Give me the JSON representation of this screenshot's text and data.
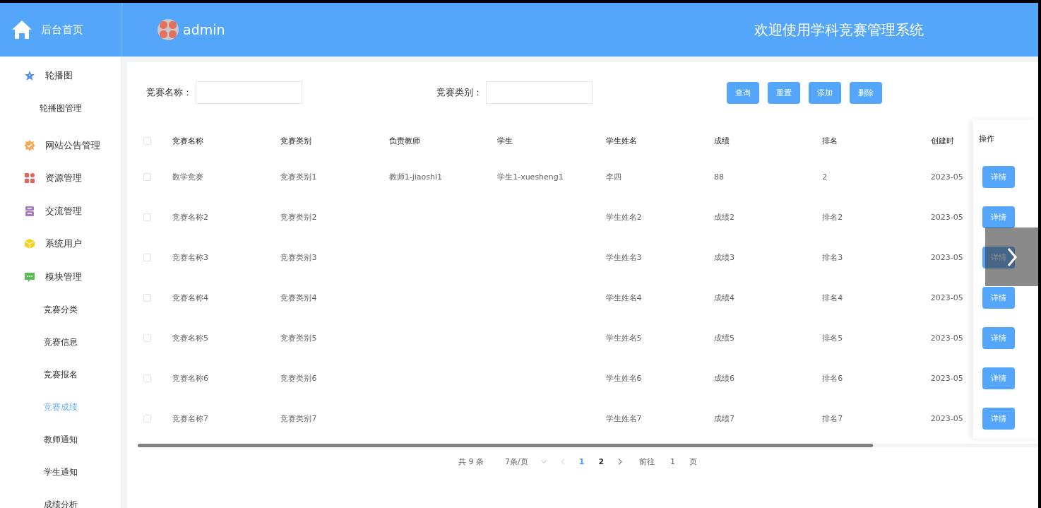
{
  "header": {
    "home_label": "后台首页",
    "username": "admin",
    "title": "欢迎使用学科竞赛管理系统"
  },
  "sidebar": {
    "groups": [
      {
        "label": "轮播图",
        "kind": "star",
        "children": [
          {
            "label": "轮播图管理",
            "selected": false
          }
        ]
      },
      {
        "label": "网站公告管理",
        "kind": "badge"
      },
      {
        "label": "资源管理",
        "kind": "grid"
      },
      {
        "label": "交流管理",
        "kind": "box"
      },
      {
        "label": "系统用户",
        "kind": "cube"
      },
      {
        "label": "模块管理",
        "kind": "chat",
        "children": [
          {
            "label": "竞赛分类",
            "selected": false
          },
          {
            "label": "竞赛信息",
            "selected": false
          },
          {
            "label": "竞赛报名",
            "selected": false
          },
          {
            "label": "竞赛成绩",
            "selected": true
          },
          {
            "label": "教师通知",
            "selected": false
          },
          {
            "label": "学生通知",
            "selected": false
          },
          {
            "label": "成绩分析",
            "selected": false
          }
        ]
      }
    ]
  },
  "search": {
    "fields": [
      {
        "label": "竞赛名称："
      },
      {
        "label": "竞赛类别："
      }
    ],
    "buttons": [
      "查询",
      "重置",
      "添加",
      "删除"
    ]
  },
  "table": {
    "header_checked": false,
    "columns": [
      "竞赛名称",
      "竞赛类别",
      "负责教师",
      "学生",
      "学生姓名",
      "成绩",
      "排名",
      "创建时"
    ],
    "action_column": "操作",
    "rows": [
      {
        "checked": false,
        "name": "数学竞赛",
        "category": "竞赛类别1",
        "teacher": "教师1-jiaoshi1",
        "student": "学生1-xuesheng1",
        "student_name": "李四",
        "score": "88",
        "rank": "2",
        "created": "2023-05",
        "action": "详情"
      },
      {
        "checked": false,
        "name": "竞赛名称2",
        "category": "竞赛类别2",
        "student_name": "学生姓名2",
        "score": "成绩2",
        "rank": "排名2",
        "created": "2023-05",
        "action": "详情"
      },
      {
        "checked": false,
        "name": "竞赛名称3",
        "category": "竞赛类别3",
        "student_name": "学生姓名3",
        "score": "成绩3",
        "rank": "排名3",
        "created": "2023-05",
        "action": "详情"
      },
      {
        "checked": false,
        "name": "竞赛名称4",
        "category": "竞赛类别4",
        "student_name": "学生姓名4",
        "score": "成绩4",
        "rank": "排名4",
        "created": "2023-05",
        "action": "详情"
      },
      {
        "checked": false,
        "name": "竞赛名称5",
        "category": "竞赛类别5",
        "student_name": "学生姓名5",
        "score": "成绩5",
        "rank": "排名5",
        "created": "2023-05",
        "action": "详情"
      },
      {
        "checked": false,
        "name": "竞赛名称6",
        "category": "竞赛类别6",
        "student_name": "学生姓名6",
        "score": "成绩6",
        "rank": "排名6",
        "created": "2023-05",
        "action": "详情"
      },
      {
        "checked": false,
        "name": "竞赛名称7",
        "category": "竞赛类别7",
        "student_name": "学生姓名7",
        "score": "成绩7",
        "rank": "排名7",
        "created": "2023-05",
        "action": "详情"
      }
    ]
  },
  "pagination": {
    "total": "共 9 条",
    "page_size": "7条/页",
    "pages": [
      {
        "label": "1",
        "selected": true
      },
      {
        "label": "2",
        "selected": false
      }
    ],
    "goto_label": "前往",
    "goto_value": "1",
    "goto_suffix": "页"
  }
}
